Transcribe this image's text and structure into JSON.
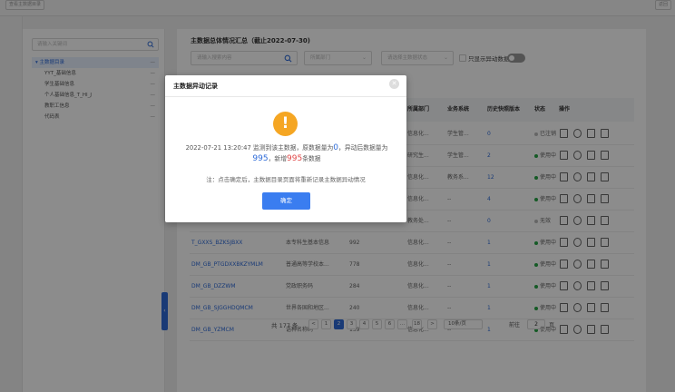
{
  "topbar": {
    "left_button": "查看主数据目录",
    "right_button": "返回"
  },
  "sidebar": {
    "search_placeholder": "请输入关键词",
    "root": "▾ 主数据目录",
    "items": [
      {
        "label": "YYT_基础信息"
      },
      {
        "label": "学生基础信息"
      },
      {
        "label": "个人基础信息_T_HI_J"
      },
      {
        "label": "教职工信息"
      },
      {
        "label": "代码表"
      }
    ]
  },
  "main": {
    "title": "主数据总体情况汇总（截止2022-07-30)",
    "filters": {
      "search_placeholder": "请输入搜索内容",
      "dept_placeholder": "所属部门",
      "status_placeholder": "请选择主数据状态",
      "toggle_label": "只显示异动数据"
    },
    "table": {
      "headers": [
        "所属部门",
        "业务系统",
        "历史快照版本",
        "状态",
        "操作"
      ],
      "rows": [
        {
          "code": "",
          "name": "",
          "count": "",
          "dept": "信息化...",
          "system": "学生管...",
          "version": "0",
          "status": "已注销",
          "status_color": "#bbbbbb"
        },
        {
          "code": "",
          "name": "",
          "count": "",
          "dept": "研究生...",
          "system": "学生管...",
          "version": "2",
          "status": "使用中",
          "status_color": "#27a545"
        },
        {
          "code": "",
          "name": "",
          "count": "",
          "dept": "信息化...",
          "system": "教务系...",
          "version": "12",
          "status": "使用中",
          "status_color": "#27a545"
        },
        {
          "code": "",
          "name": "",
          "count": "",
          "dept": "信息化...",
          "system": "--",
          "version": "4",
          "status": "使用中",
          "status_color": "#27a545"
        },
        {
          "code": "",
          "name": "",
          "count": "",
          "dept": "教务处...",
          "system": "--",
          "version": "0",
          "status": "无效",
          "status_color": "#bbbbbb"
        },
        {
          "code": "T_GXXS_BZKSJBXX",
          "name": "本专科生基本信息",
          "count": "992",
          "dept": "信息化...",
          "system": "--",
          "version": "1",
          "status": "使用中",
          "status_color": "#27a545"
        },
        {
          "code": "DM_GB_PTGDXXBKZYMLM",
          "name": "普通高等学校本...",
          "count": "778",
          "dept": "信息化...",
          "system": "--",
          "version": "1",
          "status": "使用中",
          "status_color": "#27a545"
        },
        {
          "code": "DM_GB_DZZWM",
          "name": "党政职务码",
          "count": "284",
          "dept": "信息化...",
          "system": "--",
          "version": "1",
          "status": "使用中",
          "status_color": "#27a545"
        },
        {
          "code": "DM_GB_SJGGHDQMCM",
          "name": "世界各国和地区...",
          "count": "240",
          "dept": "信息化...",
          "system": "--",
          "version": "1",
          "status": "使用中",
          "status_color": "#27a545"
        },
        {
          "code": "DM_GB_YZMCM",
          "name": "语种名称码",
          "count": "139",
          "dept": "信息化...",
          "system": "--",
          "version": "1",
          "status": "使用中",
          "status_color": "#27a545"
        }
      ]
    },
    "pager": {
      "total": "共 177 条",
      "prev": "<",
      "pages": [
        "1",
        "2",
        "3",
        "4",
        "5",
        "6",
        "…",
        "18"
      ],
      "next": ">",
      "page_size": "10条/页",
      "goto_label": "前往",
      "goto_value": "2",
      "goto_suffix": "页"
    }
  },
  "modal": {
    "title": "主数据异动记录",
    "close_glyph": "✕",
    "icon_glyph": "!",
    "msg_part1": "2022-07-21 13:20:47 监测到该主数据，原数据量为",
    "orig_count": "0",
    "msg_part2": "，异动后数据量为",
    "new_count": "995",
    "msg_part3": "，新增",
    "added_count": "995",
    "msg_part4": "条数据",
    "note": "注：点击确定后，主数据目录页面将重新记录主数据异动情况",
    "confirm": "确定"
  },
  "colors": {
    "accent": "#2e6bd8",
    "warning": "#f5a623",
    "danger": "#e04848",
    "success": "#27a545"
  }
}
